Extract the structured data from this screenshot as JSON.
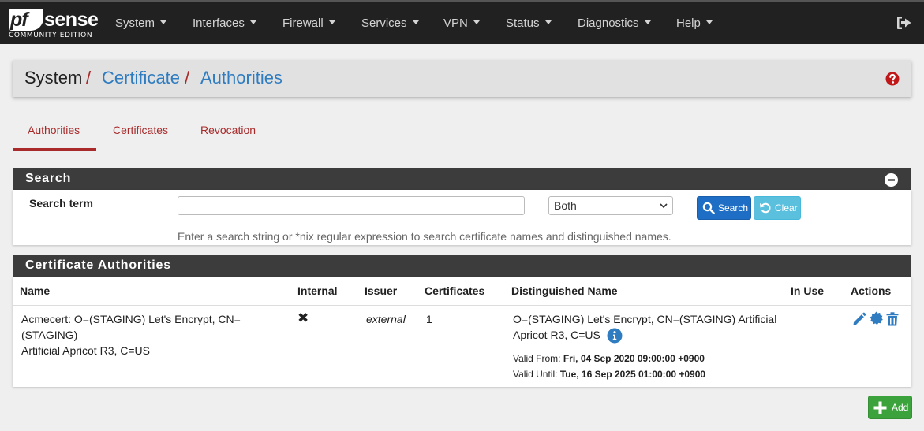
{
  "brand": {
    "logo_pf": "pf",
    "logo_sense": "sense",
    "edition": "COMMUNITY EDITION"
  },
  "nav": {
    "items": [
      {
        "label": "System"
      },
      {
        "label": "Interfaces"
      },
      {
        "label": "Firewall"
      },
      {
        "label": "Services"
      },
      {
        "label": "VPN"
      },
      {
        "label": "Status"
      },
      {
        "label": "Diagnostics"
      },
      {
        "label": "Help"
      }
    ],
    "logout_icon": "sign-out-icon"
  },
  "breadcrumb": {
    "root": "System",
    "sep": "/",
    "level1": "Certificate",
    "level2": "Authorities",
    "help_icon": "question-circle-icon"
  },
  "tabs": [
    {
      "label": "Authorities",
      "active": true
    },
    {
      "label": "Certificates"
    },
    {
      "label": "Revocation"
    }
  ],
  "search_panel": {
    "title": "Search",
    "term_label": "Search term",
    "term_value": "",
    "scope_selected": "Both",
    "search_button": "Search",
    "clear_button": "Clear",
    "help_text": "Enter a search string or *nix regular expression to search certificate names and distinguished names."
  },
  "ca_panel": {
    "title": "Certificate Authorities",
    "columns": [
      "Name",
      "Internal",
      "Issuer",
      "Certificates",
      "Distinguished Name",
      "In Use",
      "Actions"
    ],
    "rows": [
      {
        "name_line1": "Acmecert: O=(STAGING) Let's Encrypt, CN=(STAGING)",
        "name_line2": "Artificial Apricot R3, C=US",
        "internal": "✖",
        "issuer": "external",
        "certificates": "1",
        "dn_line1": "O=(STAGING) Let's Encrypt, CN=(STAGING) Artificial",
        "dn_line2": "Apricot R3, C=US",
        "valid_from_label": "Valid From:",
        "valid_from": "Fri, 04 Sep 2020 09:00:00 +0900",
        "valid_until_label": "Valid Until:",
        "valid_until": "Tue, 16 Sep 2025 01:00:00 +0900",
        "in_use": ""
      }
    ]
  },
  "add_button": "Add",
  "colors": {
    "navbar": "#212121",
    "accent_red": "#a82a2a",
    "link_blue": "#2f7cc0",
    "panel_head": "#3c3c3c",
    "primary": "#1e6ec6",
    "info": "#5bc0de",
    "success": "#3ca33c"
  }
}
